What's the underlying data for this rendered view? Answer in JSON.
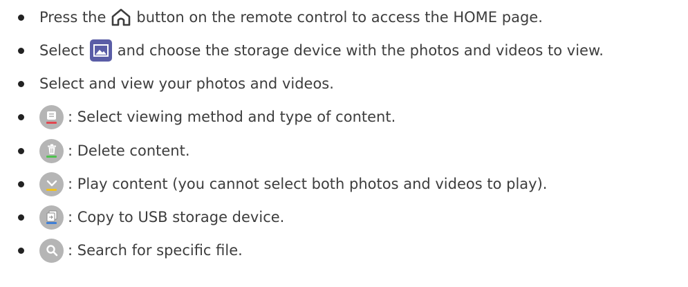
{
  "items": [
    {
      "pre": "Press the",
      "icon": "home-icon",
      "post": "button on the remote control to access the HOME page."
    },
    {
      "pre": "Select",
      "icon": "photo-video-app-icon",
      "post": "and choose the storage device with the photos and videos to view."
    },
    {
      "text": "Select and view your photos and videos."
    },
    {
      "icon": "view-options-icon",
      "icon_stripe_color": "#e2464f",
      "text": ": Select viewing method and type of content."
    },
    {
      "icon": "delete-icon",
      "icon_stripe_color": "#4fc24f",
      "text": ": Delete content."
    },
    {
      "icon": "play-select-icon",
      "icon_stripe_color": "#f2c21a",
      "text": ": Play content (you cannot select both photos and videos to play)."
    },
    {
      "icon": "copy-to-usb-icon",
      "icon_stripe_color": "#3f7fd6",
      "text": ": Copy to USB storage device."
    },
    {
      "icon": "search-icon",
      "text": ": Search for specific file."
    }
  ]
}
